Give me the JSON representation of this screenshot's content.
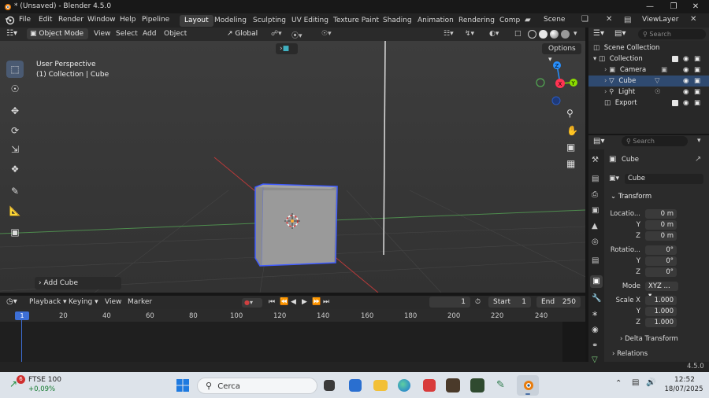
{
  "window": {
    "title": "* (Unsaved) - Blender 4.5.0",
    "controls": [
      "minimize",
      "maximize",
      "close"
    ]
  },
  "menubar": {
    "menus": [
      "File",
      "Edit",
      "Render",
      "Window",
      "Help",
      "Pipeline"
    ],
    "workspaces": [
      "Layout",
      "Modeling",
      "Sculpting",
      "UV Editing",
      "Texture Paint",
      "Shading",
      "Animation",
      "Rendering",
      "Compo"
    ],
    "active_workspace": "Layout",
    "scene": "Scene",
    "view_layer": "ViewLayer"
  },
  "viewport_header": {
    "mode": "Object Mode",
    "menus": [
      "View",
      "Select",
      "Add",
      "Object"
    ],
    "transform_orientation": "Global",
    "options_label": "Options"
  },
  "viewport": {
    "perspective_label": "User Perspective",
    "context_label": "(1) Collection | Cube",
    "gizmo_axes": [
      "Z",
      "X",
      "Y"
    ],
    "last_operator": "Add Cube"
  },
  "timeline": {
    "menus": [
      "Playback",
      "Keying",
      "View",
      "Marker"
    ],
    "current_frame": "1",
    "start_label": "Start",
    "start_value": "1",
    "end_label": "End",
    "end_value": "250",
    "ruler_current": "1",
    "ruler_ticks": [
      "20",
      "40",
      "60",
      "80",
      "100",
      "120",
      "140",
      "160",
      "180",
      "200",
      "220",
      "240"
    ]
  },
  "status": {
    "version": "4.5.0"
  },
  "outliner": {
    "search_placeholder": "Search",
    "items": [
      {
        "label": "Scene Collection",
        "level": 0
      },
      {
        "label": "Collection",
        "level": 1
      },
      {
        "label": "Camera",
        "level": 2
      },
      {
        "label": "Cube",
        "level": 2
      },
      {
        "label": "Light",
        "level": 2
      },
      {
        "label": "Export",
        "level": 1
      }
    ],
    "selected": "Cube"
  },
  "properties": {
    "search_placeholder": "Search",
    "object_name": "Cube",
    "data_name": "Cube",
    "transform_header": "Transform",
    "location_label": "Locatio...",
    "location": [
      "0 m",
      "0 m",
      "0 m"
    ],
    "rotation_label": "Rotatio...",
    "rotation": [
      "0°",
      "0°",
      "0°"
    ],
    "mode_label": "Mode",
    "mode_value": "XYZ ...",
    "scale_label": "Scale X",
    "scale": [
      "1.000",
      "1.000",
      "1.000"
    ],
    "axis_y": "Y",
    "axis_z": "Z",
    "delta_transform": "Delta Transform",
    "relations": "Relations"
  },
  "taskbar": {
    "stock_name": "FTSE 100",
    "stock_change": "+0,09%",
    "stock_badge": "6",
    "search_placeholder": "Cerca",
    "time": "12:52",
    "date": "18/07/2025"
  },
  "colors": {
    "accent_blue": "#4772b3",
    "selection_outline": "#3f5bff",
    "axis_x": "#ff3352",
    "axis_y": "#8bdc00",
    "axis_z": "#2890ff"
  }
}
